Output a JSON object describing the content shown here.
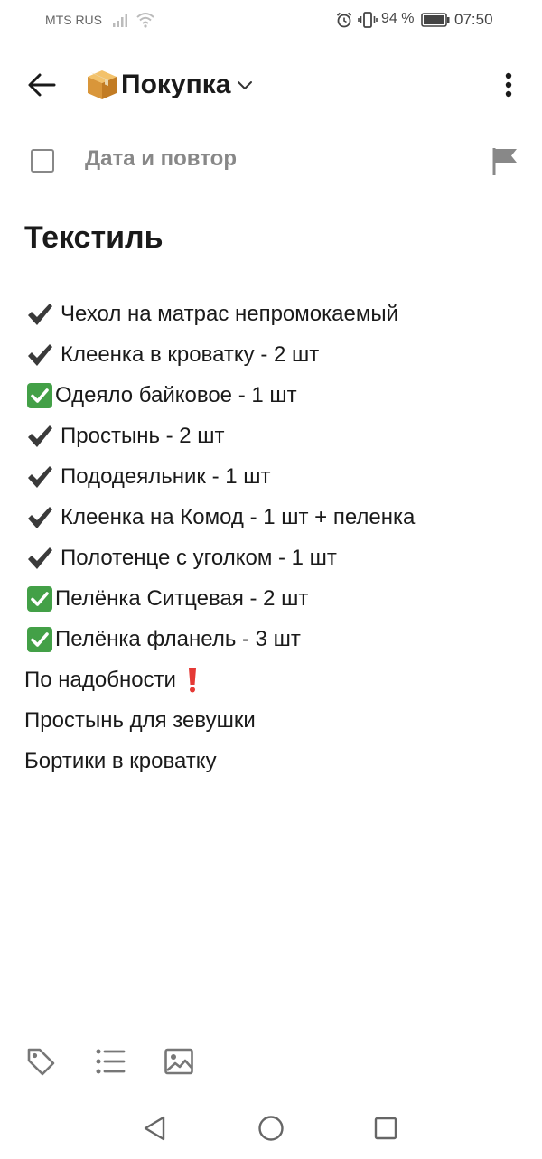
{
  "status_bar": {
    "carrier": "MTS RUS",
    "battery_percent": "94 %",
    "time": "07:50",
    "icons": [
      "signal-icon",
      "wifi-icon",
      "alarm-icon",
      "vibrate-icon",
      "battery-icon"
    ]
  },
  "header": {
    "title": "Покупка",
    "icons": [
      "back-arrow-icon",
      "package-box-icon",
      "chevron-down-icon",
      "more-vertical-icon"
    ]
  },
  "task": {
    "date_repeat": "Дата и повтор",
    "checked": false,
    "icons": [
      "checkbox-icon",
      "flag-icon"
    ]
  },
  "note": {
    "heading": "Текстиль",
    "lines": [
      {
        "mark": "check",
        "text": "Чехол на матрас непромокаемый"
      },
      {
        "mark": "check",
        "text": "Клеенка в кроватку - 2 шт"
      },
      {
        "mark": "check-box",
        "text": "Одеяло байковое - 1 шт"
      },
      {
        "mark": "check",
        "text": "Простынь - 2 шт"
      },
      {
        "mark": "check",
        "text": "Пододеяльник - 1 шт"
      },
      {
        "mark": "check",
        "text": "Клеенка на Комод - 1 шт + пеленка"
      },
      {
        "mark": "check",
        "text": "Полотенце с уголком - 1 шт"
      },
      {
        "mark": "check-box",
        "text": "Пелёнка Ситцевая - 2 шт"
      },
      {
        "mark": "check-box",
        "text": "Пелёнка фланель - 3 шт"
      },
      {
        "mark": "",
        "text": "По надобности",
        "suffix": "exclamation"
      },
      {
        "mark": "",
        "text": "Простынь для зевушки"
      },
      {
        "mark": "",
        "text": "Бортики в кроватку"
      }
    ]
  },
  "toolbar": {
    "icons": [
      "tag-icon",
      "checklist-icon",
      "image-icon"
    ]
  },
  "nav_bar": {
    "icons": [
      "nav-back-icon",
      "nav-home-icon",
      "nav-recent-icon"
    ]
  },
  "colors": {
    "text": "#1a1a1a",
    "muted": "#888888",
    "check_green": "#43a047",
    "exclamation_red": "#e53935"
  }
}
